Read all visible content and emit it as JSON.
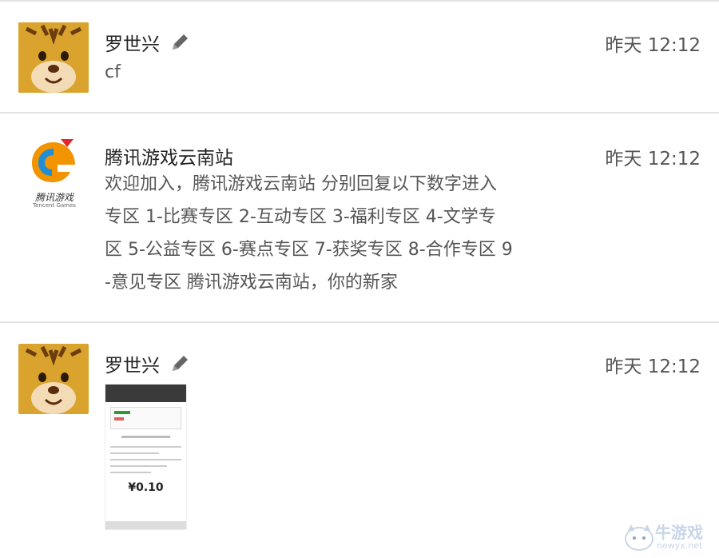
{
  "messages": [
    {
      "name": "罗世兴",
      "time": "昨天 12:12",
      "text": "cf",
      "avatar": "tiger-avatar",
      "edit_icon": "pencil-icon"
    },
    {
      "name": "腾讯游戏云南站",
      "time": "昨天 12:12",
      "text_lines": [
        "欢迎加入，腾讯游戏云南站 分别回复以下数字进入",
        "专区 1-比赛专区 2-互动专区 3-福利专区 4-文学专",
        "区 5-公益专区 6-赛点专区 7-获奖专区 8-合作专区 9",
        "-意见专区 腾讯游戏云南站，你的新家"
      ],
      "avatar": "tencent-games-logo",
      "logo_text": "腾讯游戏",
      "logo_subtext": "Tencent Games"
    },
    {
      "name": "罗世兴",
      "time": "昨天 12:12",
      "avatar": "tiger-avatar",
      "edit_icon": "pencil-icon",
      "image_amount": "¥0.10"
    }
  ],
  "watermark": {
    "title": "牛游戏",
    "url": "newyx.net"
  },
  "colors": {
    "divider": "#e2e2e2",
    "name": "#222222",
    "text": "#555555",
    "logo_orange": "#f29300",
    "logo_blue": "#1e8ed6"
  }
}
